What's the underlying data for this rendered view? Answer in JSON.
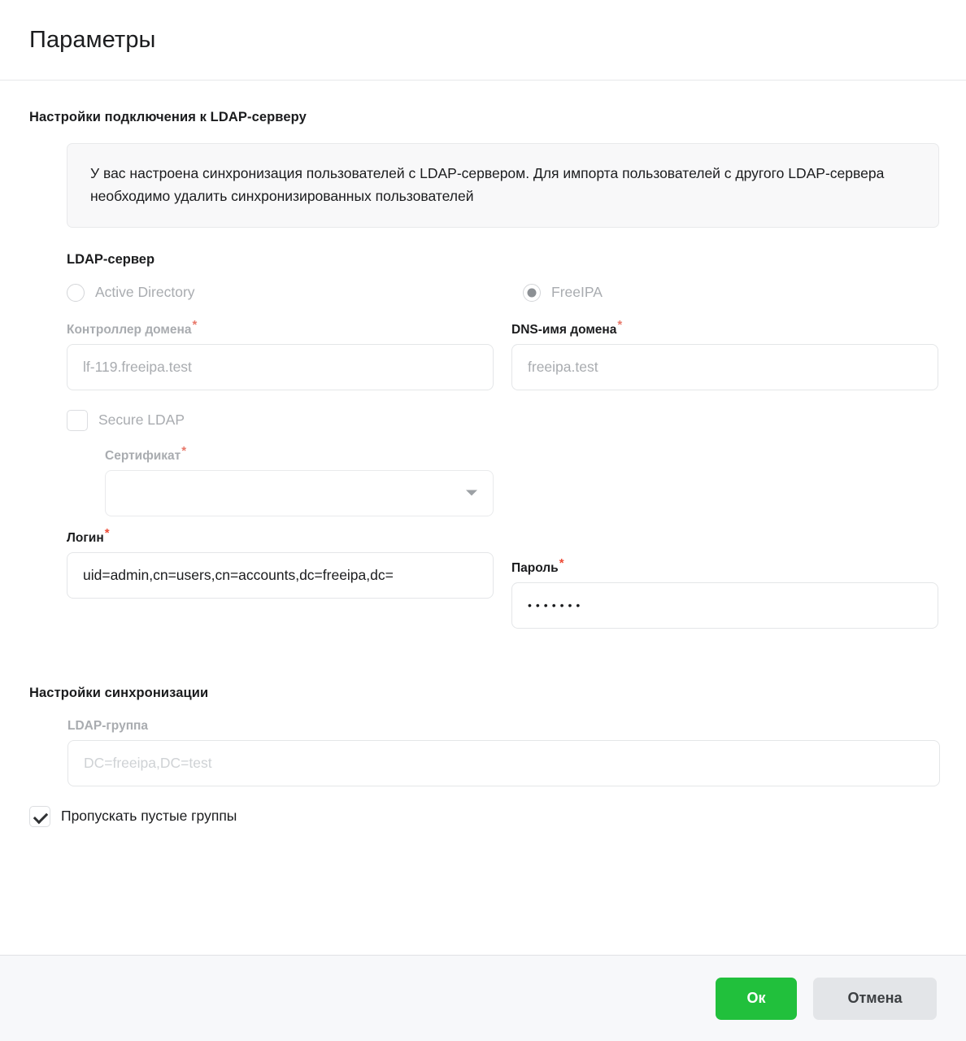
{
  "dialog": {
    "title": "Параметры"
  },
  "connection": {
    "section_title": "Настройки подключения к LDAP-серверу",
    "notice": "У вас настроена синхронизация пользователей с LDAP-сервером. Для импорта пользователей с другого LDAP-сервера необходимо удалить синхронизированных пользователей",
    "server_group_title": "LDAP-сервер",
    "options": [
      {
        "label": "Active Directory",
        "selected": false
      },
      {
        "label": "FreeIPA",
        "selected": true
      }
    ],
    "domain_controller": {
      "label": "Контроллер домена",
      "required_marker": "*",
      "value": "lf-119.freeipa.test",
      "placeholder": "lf-119.freeipa.test"
    },
    "dns_domain": {
      "label": "DNS-имя домена",
      "required_marker": "*",
      "value": "freeipa.test",
      "placeholder": "freeipa.test"
    },
    "secure_ldap": {
      "label": "Secure LDAP",
      "checked": false
    },
    "certificate": {
      "label": "Сертификат",
      "required_marker": "*",
      "value": "",
      "caret": "chevron-down-icon"
    },
    "login": {
      "label": "Логин",
      "required_marker": "*",
      "value": "uid=admin,cn=users,cn=accounts,dc=freeipa,dc="
    },
    "password": {
      "label": "Пароль",
      "required_marker": "*",
      "value": "•••••••"
    }
  },
  "sync": {
    "section_title": "Настройки синхронизации",
    "ldap_group": {
      "label": "LDAP-группа",
      "value": "",
      "placeholder": "DC=freeipa,DC=test"
    },
    "skip_empty_groups": {
      "label": "Пропускать пустые группы",
      "checked": true
    }
  },
  "footer": {
    "ok_label": "Ок",
    "cancel_label": "Отмена"
  },
  "colors": {
    "ok_button": "#21c03c",
    "cancel_button": "#e3e5e8",
    "required_marker": "#ee4b36",
    "footer_background": "#f7f8fa",
    "notice_background": "#f8f8f9"
  }
}
